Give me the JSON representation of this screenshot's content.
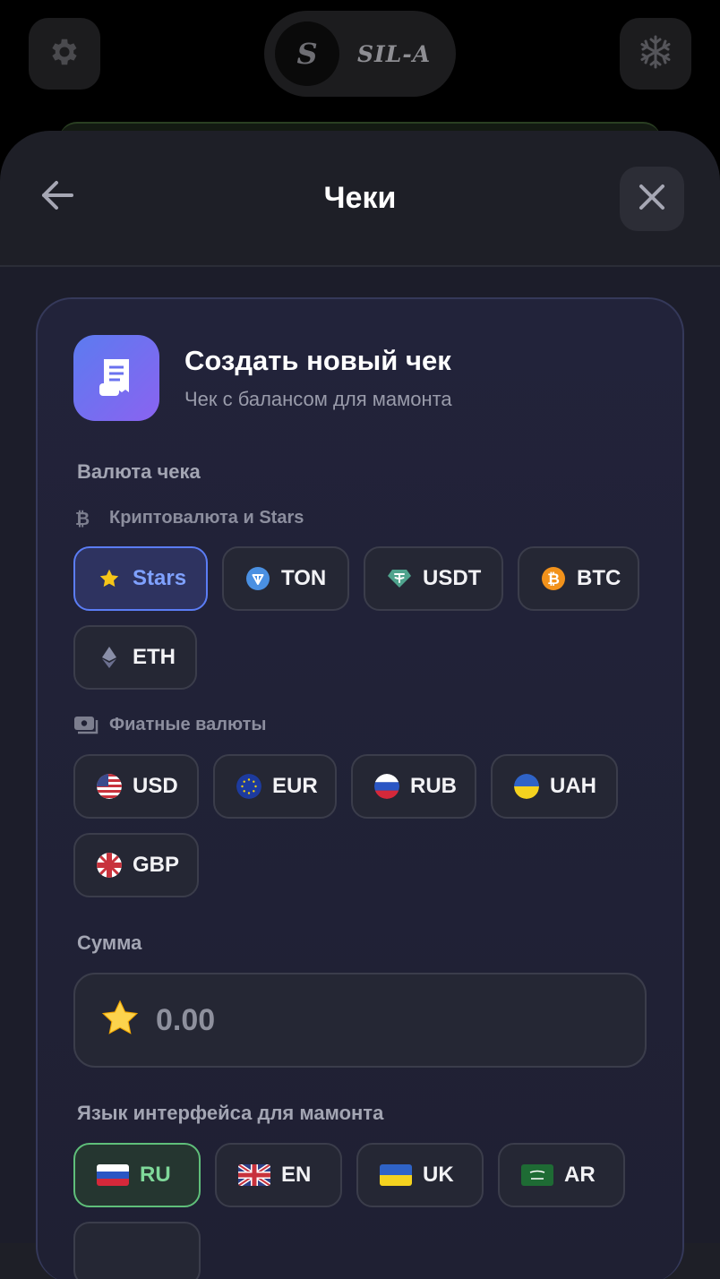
{
  "app": {
    "brand_name": "SIL-A"
  },
  "topbar": {
    "left_icon": "gear-icon",
    "right_icon": "snowflake-icon"
  },
  "sheet": {
    "title": "Чеки",
    "back_icon": "arrow-left-icon",
    "close_icon": "close-icon"
  },
  "card": {
    "title": "Создать новый чек",
    "subtitle": "Чек с балансом для мамонта"
  },
  "currency": {
    "label": "Валюта чека",
    "crypto_label": "Криптовалюта и Stars",
    "fiat_label": "Фиатные валюты",
    "crypto": [
      {
        "code": "Stars",
        "icon": "star-icon",
        "selected": true
      },
      {
        "code": "TON",
        "icon": "ton-icon",
        "selected": false
      },
      {
        "code": "USDT",
        "icon": "tether-icon",
        "selected": false
      },
      {
        "code": "BTC",
        "icon": "bitcoin-icon",
        "selected": false
      },
      {
        "code": "ETH",
        "icon": "ethereum-icon",
        "selected": false
      }
    ],
    "fiat": [
      {
        "code": "USD",
        "icon": "us-flag-icon"
      },
      {
        "code": "EUR",
        "icon": "eu-flag-icon"
      },
      {
        "code": "RUB",
        "icon": "ru-flag-icon"
      },
      {
        "code": "UAH",
        "icon": "ua-flag-icon"
      },
      {
        "code": "GBP",
        "icon": "gb-flag-icon"
      }
    ]
  },
  "amount": {
    "label": "Сумма",
    "placeholder": "0.00",
    "icon": "star-emoji-icon"
  },
  "language": {
    "label": "Язык интерфейса для мамонта",
    "options": [
      {
        "code": "RU",
        "icon": "ru-flag-icon",
        "selected": true
      },
      {
        "code": "EN",
        "icon": "gb-flag-icon",
        "selected": false
      },
      {
        "code": "UK",
        "icon": "ua-flag-icon",
        "selected": false
      },
      {
        "code": "AR",
        "icon": "sa-flag-icon",
        "selected": false
      }
    ]
  },
  "colors": {
    "accent_blue": "#5b7df5",
    "accent_green": "#5fbf7a",
    "sheet_bg": "#1e1f27"
  }
}
